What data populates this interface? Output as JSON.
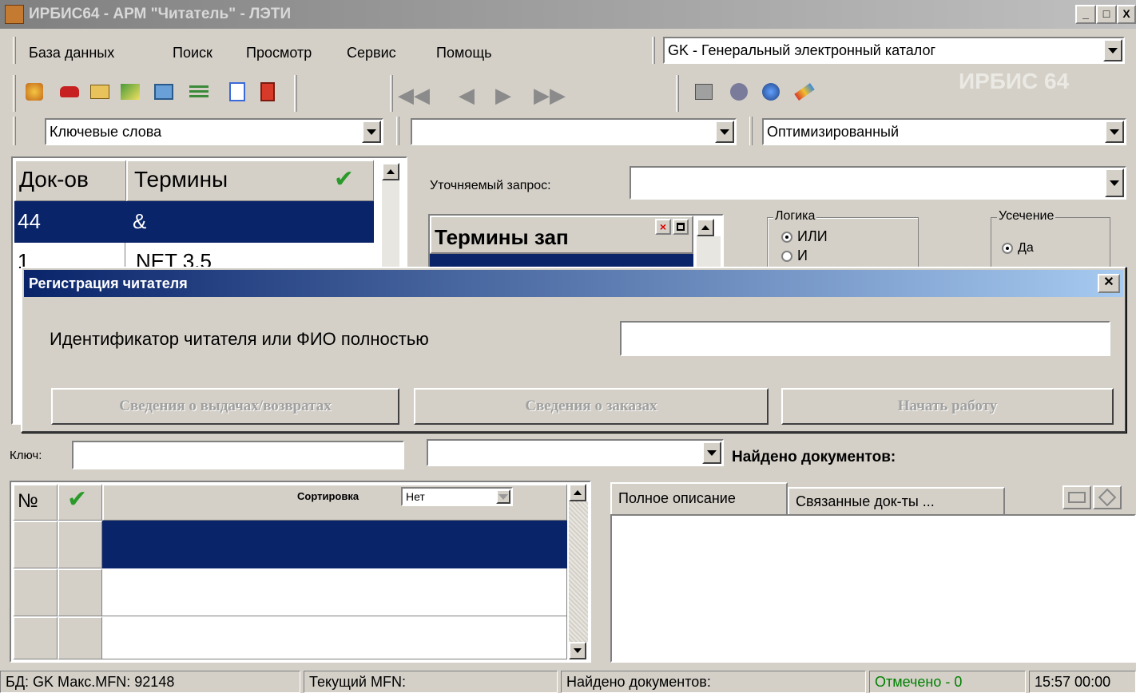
{
  "window": {
    "title": "ИРБИС64 - АРМ \"Читатель\" - ЛЭТИ",
    "controls": [
      "_",
      "□",
      "X"
    ]
  },
  "menu": {
    "items": [
      "База данных",
      "Поиск",
      "Просмотр",
      "Сервис",
      "Помощь"
    ]
  },
  "database_select": {
    "value": "GK - Генеральный электронный каталог"
  },
  "toolbar": {
    "icons": [
      "open-db-icon",
      "red-car-icon",
      "folder-icon",
      "exchange-icon",
      "display-icon",
      "list-icon",
      "report-icon",
      "book-icon"
    ],
    "nav": [
      "first-record-icon",
      "prev-record-icon",
      "next-record-icon",
      "last-record-icon"
    ],
    "tools": [
      "print-icon",
      "settings-icon",
      "globe-icon",
      "edit-icon"
    ],
    "watermark": "ИРБИС 64"
  },
  "search_bar": {
    "prefix_select": "Ключевые слова",
    "middle_select": "",
    "mode_select": "Оптимизированный"
  },
  "dictionary": {
    "headers": {
      "docs": "Док-ов",
      "terms": "Термины"
    },
    "rows": [
      {
        "count": "44",
        "term": "&"
      },
      {
        "count": "1",
        "term": "NET 3.5"
      }
    ],
    "key_label": "Ключ:",
    "key_value": ""
  },
  "query": {
    "label": "Уточняемый запрос:",
    "value": "",
    "terms_header": "Термины зап",
    "logic": {
      "title": "Логика",
      "options": [
        "ИЛИ",
        "И"
      ],
      "selected": 0
    },
    "truncation": {
      "title": "Усечение",
      "option": "Да"
    },
    "found_label": "Найдено документов:"
  },
  "dialog": {
    "title": "Регистрация читателя",
    "prompt": "Идентификатор читателя или ФИО полностью",
    "input_value": "",
    "buttons": {
      "loans": "Сведения о выдачах/возвратах",
      "orders": "Сведения о заказах",
      "start": "Начать работу"
    }
  },
  "results": {
    "col_no": "№",
    "sort_label": "Сортировка",
    "sort_value": "Нет"
  },
  "detail_tabs": {
    "full": "Полное описание",
    "linked": "Связанные док-ты ..."
  },
  "statusbar": {
    "db": "БД: GK Макс.MFN: 92148",
    "current_mfn": "Текущий MFN:",
    "found": "Найдено документов:",
    "marked": "Отмечено - 0",
    "time": "15:57  00:00"
  },
  "colors": {
    "titlebar_start": "#0a246a",
    "titlebar_end": "#a6caf0",
    "selection": "#0a246a",
    "marked_text": "#008000"
  }
}
